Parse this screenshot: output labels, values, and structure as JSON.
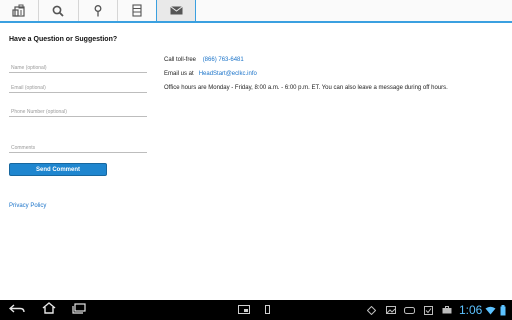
{
  "tabs": [
    {
      "icon": "building-icon"
    },
    {
      "icon": "search-icon"
    },
    {
      "icon": "map-pin-icon"
    },
    {
      "icon": "document-icon"
    },
    {
      "icon": "envelope-icon",
      "active": true
    }
  ],
  "page": {
    "heading": "Have a Question or Suggestion?"
  },
  "form": {
    "name_placeholder": "Name (optional)",
    "email_placeholder": "Email (optional)",
    "phone_placeholder": "Phone Number (optional)",
    "comments_placeholder": "Comments",
    "send_label": "Send Comment"
  },
  "privacy_label": "Privacy Policy",
  "contact": {
    "call_label": "Call toll-free",
    "phone": "(866) 763-6481",
    "email_label": "Email us at",
    "email": "HeadStart@eclkc.info",
    "hours": "Office hours are Monday - Friday, 8:00 a.m. - 6:00 p.m. ET. You can also leave a message during off hours."
  },
  "status_bar": {
    "time": "1:06",
    "accent": "#5cc2ff"
  },
  "colors": {
    "accent": "#3aa0e0",
    "button": "#1f86cf",
    "link": "#1a73c9"
  }
}
